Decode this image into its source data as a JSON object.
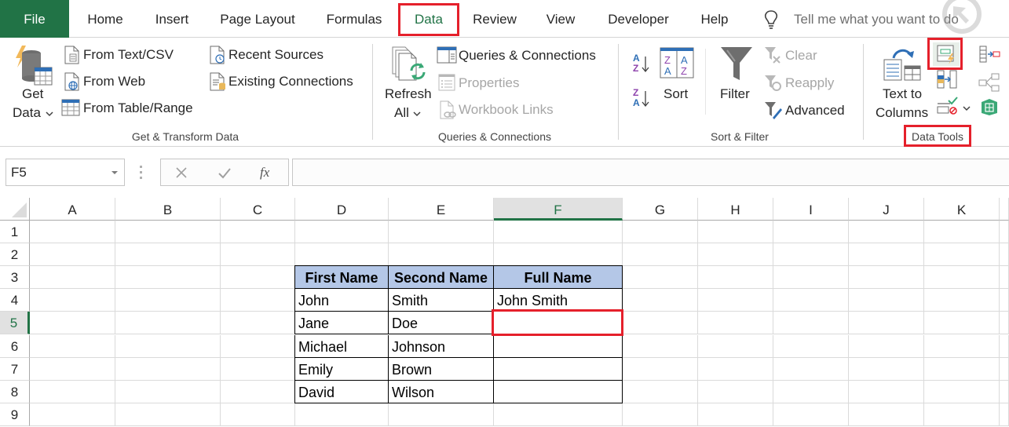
{
  "tabs": {
    "file": "File",
    "items": [
      "Home",
      "Insert",
      "Page Layout",
      "Formulas",
      "Data",
      "Review",
      "View",
      "Developer",
      "Help"
    ],
    "active": "Data",
    "tell_me_placeholder": "Tell me what you want to do"
  },
  "ribbon": {
    "get_transform": {
      "label": "Get & Transform Data",
      "get_data_line1": "Get",
      "get_data_line2": "Data",
      "from_text_csv": "From Text/CSV",
      "from_web": "From Web",
      "from_table_range": "From Table/Range",
      "recent_sources": "Recent Sources",
      "existing_connections": "Existing Connections"
    },
    "queries": {
      "label": "Queries & Connections",
      "refresh_line1": "Refresh",
      "refresh_line2": "All",
      "queries_connections": "Queries & Connections",
      "properties": "Properties",
      "workbook_links": "Workbook Links"
    },
    "sort_filter": {
      "label": "Sort & Filter",
      "sort": "Sort",
      "filter": "Filter",
      "clear": "Clear",
      "reapply": "Reapply",
      "advanced": "Advanced"
    },
    "data_tools": {
      "label": "Data Tools",
      "text_to_columns_line1": "Text to",
      "text_to_columns_line2": "Columns"
    }
  },
  "formula_bar": {
    "name_box": "F5",
    "formula": ""
  },
  "sheet": {
    "columns": [
      "A",
      "B",
      "C",
      "D",
      "E",
      "F",
      "G",
      "H",
      "I",
      "J",
      "K"
    ],
    "selected_column": "F",
    "rows": [
      "1",
      "2",
      "3",
      "4",
      "5",
      "6",
      "7",
      "8",
      "9"
    ],
    "selected_row": "5",
    "active_cell": "F5",
    "table": {
      "headers": [
        "First Name",
        "Second Name",
        "Full Name"
      ],
      "rows": [
        [
          "John",
          "Smith",
          "John Smith"
        ],
        [
          "Jane",
          "Doe",
          ""
        ],
        [
          "Michael",
          "Johnson",
          ""
        ],
        [
          "Emily",
          "Brown",
          ""
        ],
        [
          "David",
          "Wilson",
          ""
        ]
      ]
    }
  },
  "colors": {
    "excel_green": "#217346",
    "highlight_red": "#e5202b",
    "table_header_fill": "#b4c7e7"
  }
}
